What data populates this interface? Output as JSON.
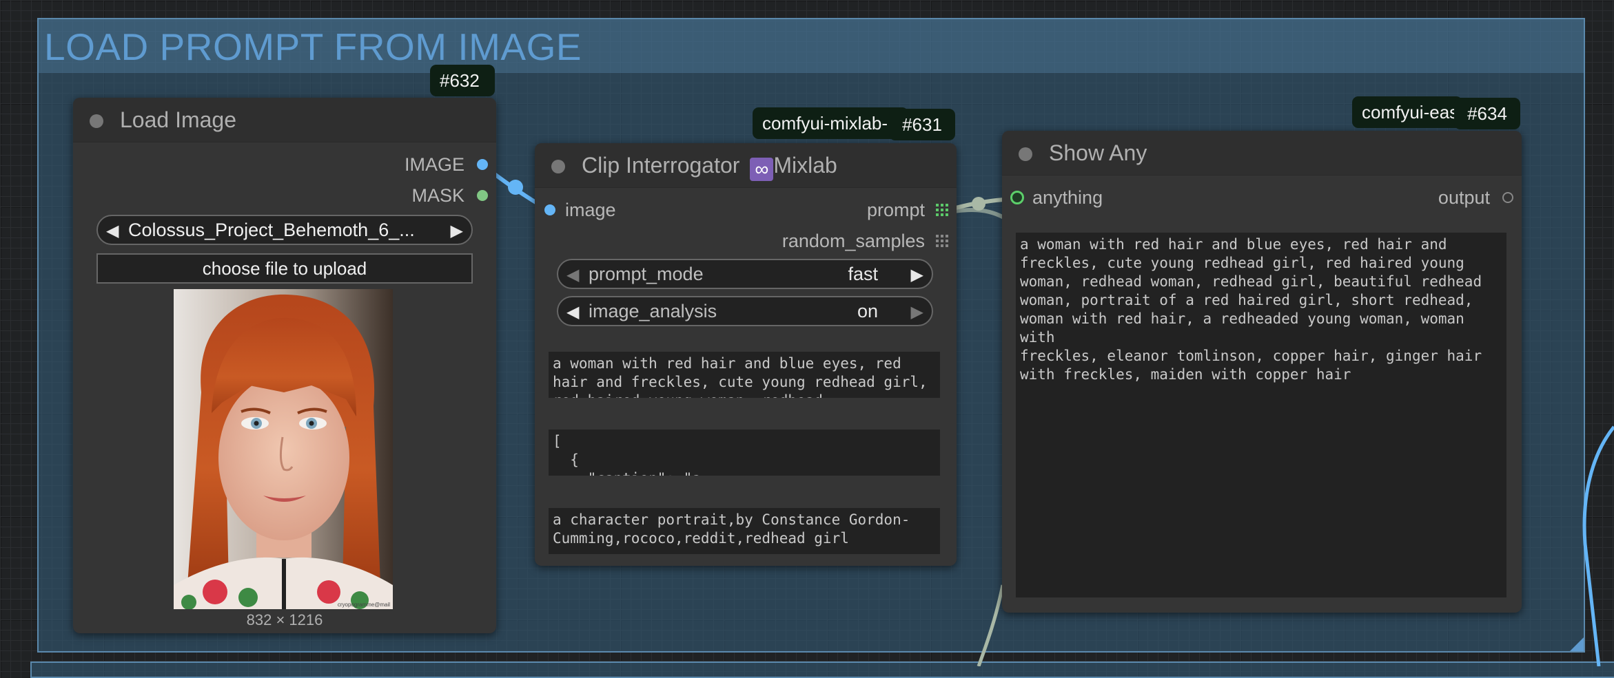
{
  "group": {
    "title": "LOAD PROMPT FROM IMAGE"
  },
  "load_image": {
    "badge": "#632",
    "title": "Load Image",
    "outputs": [
      "IMAGE",
      "MASK"
    ],
    "file_combo": "Colossus_Project_Behemoth_6_...",
    "upload_button": "choose file to upload",
    "image_size": "832 × 1216",
    "image_watermark": "cryopogramme@mail",
    "colors": {
      "image_slot": "#64b5f6",
      "mask_slot": "#81c784"
    }
  },
  "clip": {
    "badge_source": "comfyui-mixlab-",
    "badge_id": "#631",
    "title": "Clip Interrogator",
    "title_suffix": "Mixlab",
    "title_icon": "infinity-icon",
    "input": "image",
    "outputs": [
      "prompt",
      "random_samples"
    ],
    "prompt_mode": {
      "label": "prompt_mode",
      "value": "fast"
    },
    "image_analysis": {
      "label": "image_analysis",
      "value": "on"
    },
    "text1": "a woman with red hair and blue eyes, red\nhair and freckles, cute young redhead girl,\nred haired young woman, redhead",
    "text2": "[\n  {\n    \"caption\": \"a",
    "text3": "a character portrait,by Constance Gordon-\nCumming,rococo,reddit,redhead girl"
  },
  "show_any": {
    "badge_source": "comfyui-eas",
    "badge_id": "#634",
    "title": "Show Any",
    "input": "anything",
    "output": "output",
    "text": "a woman with red hair and blue eyes, red hair and\nfreckles, cute young redhead girl, red haired young\nwoman, redhead woman, redhead girl, beautiful redhead\nwoman, portrait of a red haired girl, short redhead,\nwoman with red hair, a redheaded young woman, woman with\nfreckles, eleanor tomlinson, copper hair, ginger hair\nwith freckles, maiden with copper hair"
  },
  "link_colors": {
    "image": "#64b5f6",
    "string": "#a9b8a6"
  }
}
